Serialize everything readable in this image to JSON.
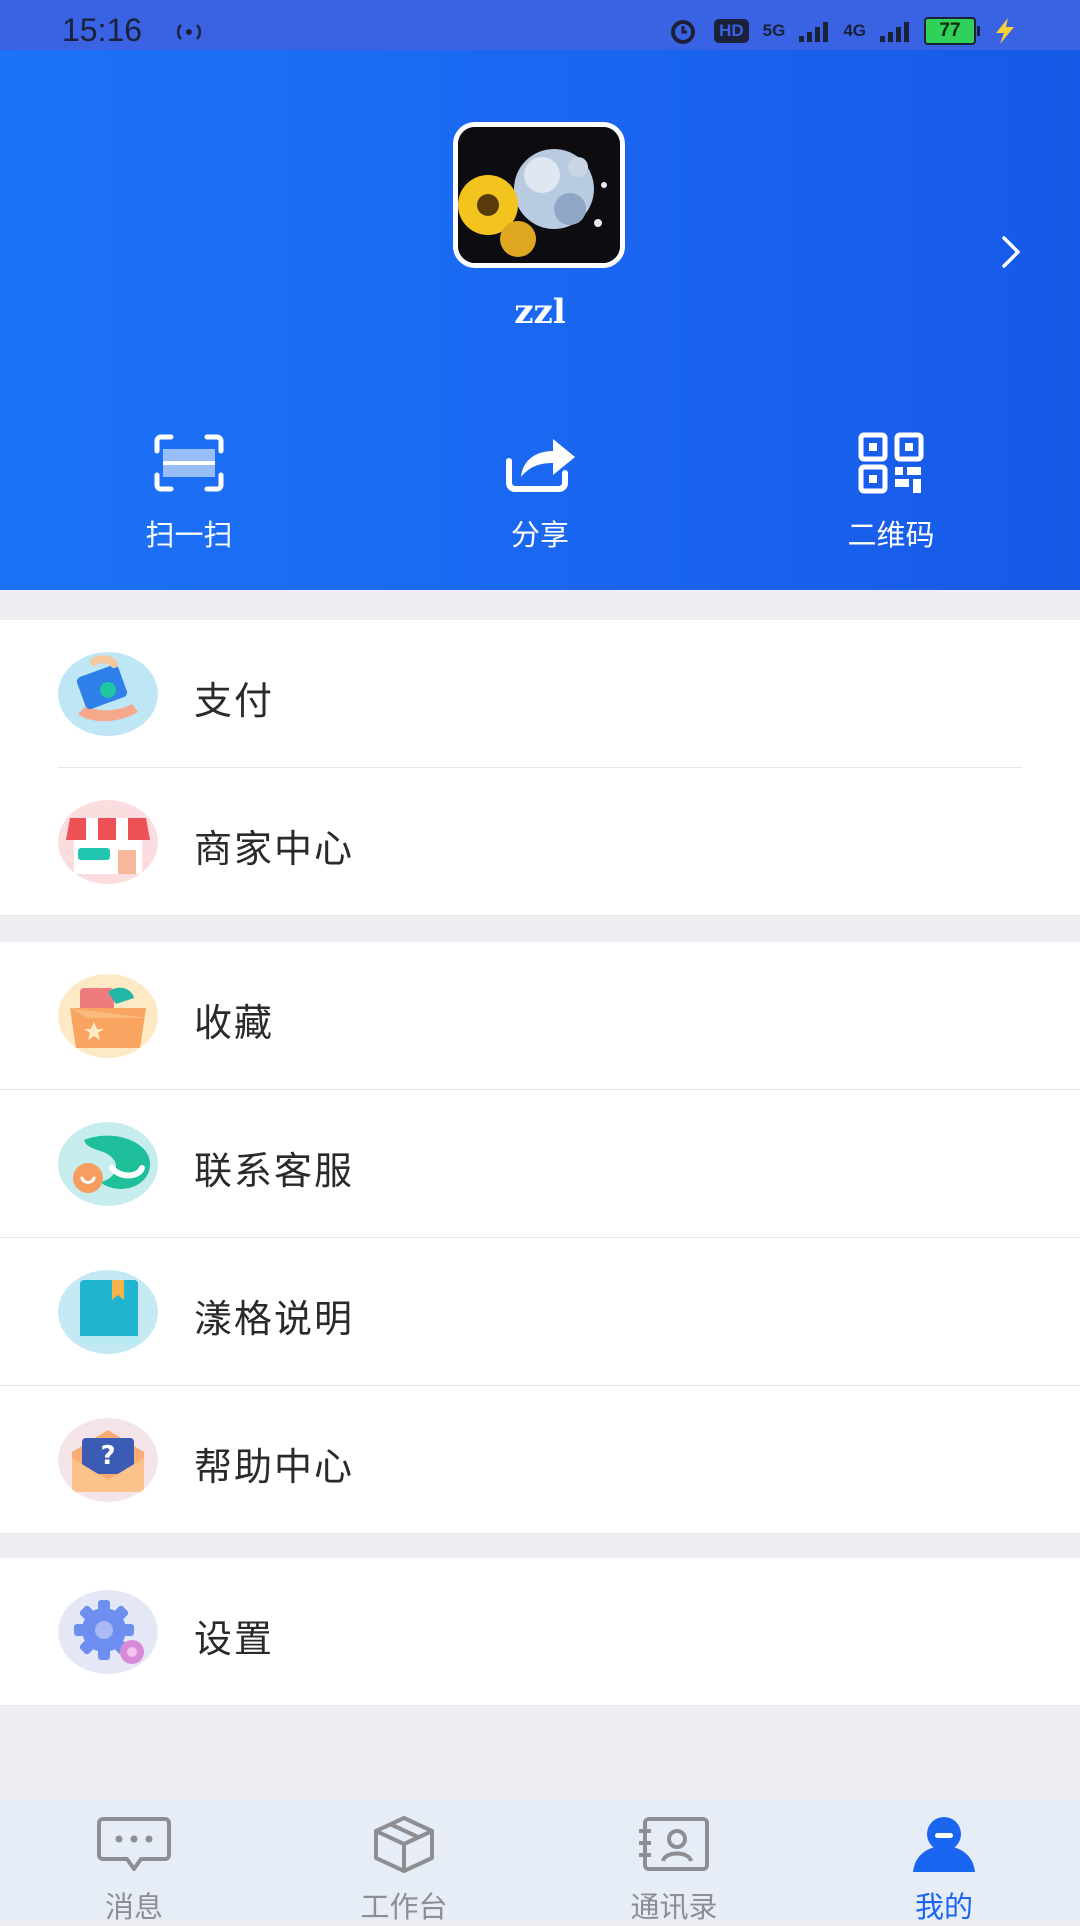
{
  "status": {
    "time": "15:16",
    "hd_label": "HD",
    "sim_label": "5G",
    "net_label": "4G",
    "battery": "77"
  },
  "profile": {
    "username": "zzl"
  },
  "quick_actions": [
    {
      "label": "扫一扫",
      "icon": "scan-icon"
    },
    {
      "label": "分享",
      "icon": "share-icon"
    },
    {
      "label": "二维码",
      "icon": "qr-code-icon"
    }
  ],
  "menu": {
    "group1": [
      {
        "label": "支付",
        "icon": "payment-icon"
      },
      {
        "label": "商家中心",
        "icon": "shop-icon"
      }
    ],
    "group2": [
      {
        "label": "收藏",
        "icon": "favorites-box-icon"
      },
      {
        "label": "联系客服",
        "icon": "customer-service-icon"
      },
      {
        "label": "漾格说明",
        "icon": "book-icon"
      },
      {
        "label": "帮助中心",
        "icon": "help-envelope-icon"
      }
    ],
    "group3": [
      {
        "label": "设置",
        "icon": "settings-gear-icon"
      }
    ]
  },
  "tabs": [
    {
      "label": "消息",
      "icon": "message-icon",
      "active": false
    },
    {
      "label": "工作台",
      "icon": "workbench-cube-icon",
      "active": false
    },
    {
      "label": "通讯录",
      "icon": "contacts-icon",
      "active": false
    },
    {
      "label": "我的",
      "icon": "profile-icon",
      "active": true
    }
  ],
  "colors": {
    "header_blue": "#1a66f1",
    "active_tab": "#1a66f1",
    "inactive_tab": "#8d8d92",
    "page_bg": "#f1eef3"
  }
}
